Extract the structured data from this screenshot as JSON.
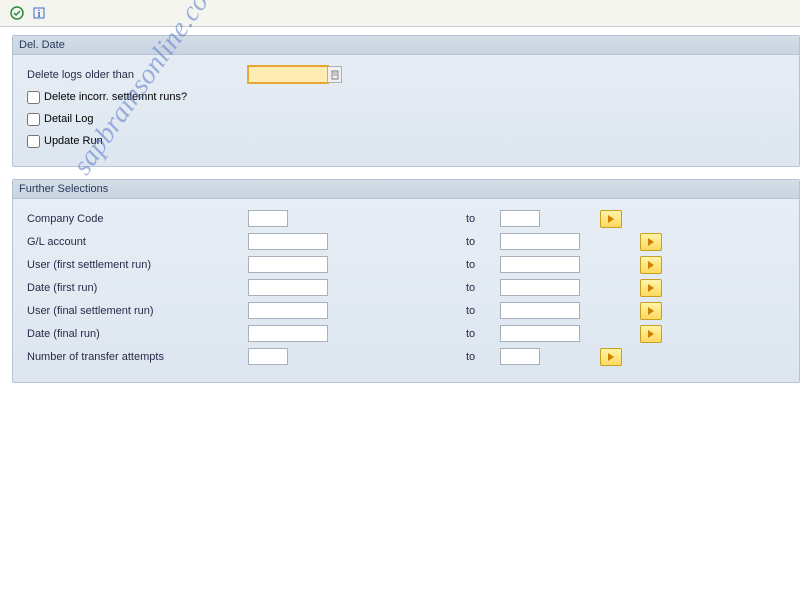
{
  "toolbar": {
    "execute_tip": "Execute",
    "info_tip": "Information"
  },
  "panel1": {
    "title": "Del. Date",
    "delete_older_label": "Delete logs older than",
    "chk_delete_incorr": "Delete incorr. settlemnt runs?",
    "chk_detail_log": "Detail Log",
    "chk_update_run": "Update Run"
  },
  "panel2": {
    "title": "Further Selections",
    "rows": {
      "company_code": "Company Code",
      "gl_account": "G/L account",
      "user_first": "User (first settlement run)",
      "date_first": "Date (first run)",
      "user_final": "User (final settlement run)",
      "date_final": "Date (final run)",
      "transfer_attempts": "Number of transfer attempts"
    },
    "to_label": "to"
  },
  "watermark": "sapbrainsonline.com"
}
